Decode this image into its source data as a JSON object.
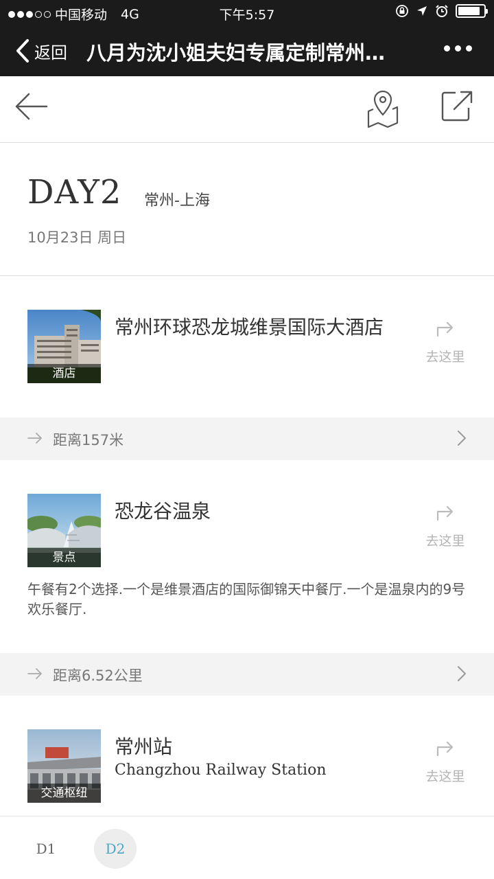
{
  "status_bar": {
    "carrier": "中国移动",
    "network": "4G",
    "time": "下午5:57",
    "signal_bars_filled": 3,
    "signal_bars_total": 5,
    "battery_level": 0.85,
    "icons": [
      "rotation-lock-icon",
      "location-arrow-icon",
      "alarm-icon",
      "battery-icon"
    ]
  },
  "nav": {
    "back_label": "返回",
    "title": "八月为沈小姐夫妇专属定制常州…"
  },
  "toolbar": {
    "icons": [
      "arrow-left-icon",
      "map-pin-icon",
      "share-icon"
    ]
  },
  "day": {
    "title": "DAY2",
    "route": "常州-上海",
    "date": "10月23日 周日"
  },
  "items": [
    {
      "name": "常州环球恐龙城维景国际大酒店",
      "subtitle": "",
      "tag": "酒店",
      "go_label": "去这里",
      "description": "",
      "distance": "距离157米"
    },
    {
      "name": "恐龙谷温泉",
      "subtitle": "",
      "tag": "景点",
      "go_label": "去这里",
      "description": "午餐有2个选择.一个是维景酒店的国际御锦天中餐厅.一个是温泉内的9号欢乐餐厅.",
      "distance": "距离6.52公里"
    },
    {
      "name": "常州站",
      "subtitle": "Changzhou Railway Station",
      "tag": "交通枢纽",
      "go_label": "去这里",
      "description": "",
      "distance": ""
    }
  ],
  "day_tabs": [
    {
      "label": "D1",
      "active": false
    },
    {
      "label": "D2",
      "active": true
    }
  ],
  "colors": {
    "top_bar": "#1b1b1c",
    "active_tab_text": "#4aa7c6",
    "distance_bar_bg": "#f3f3f3"
  }
}
